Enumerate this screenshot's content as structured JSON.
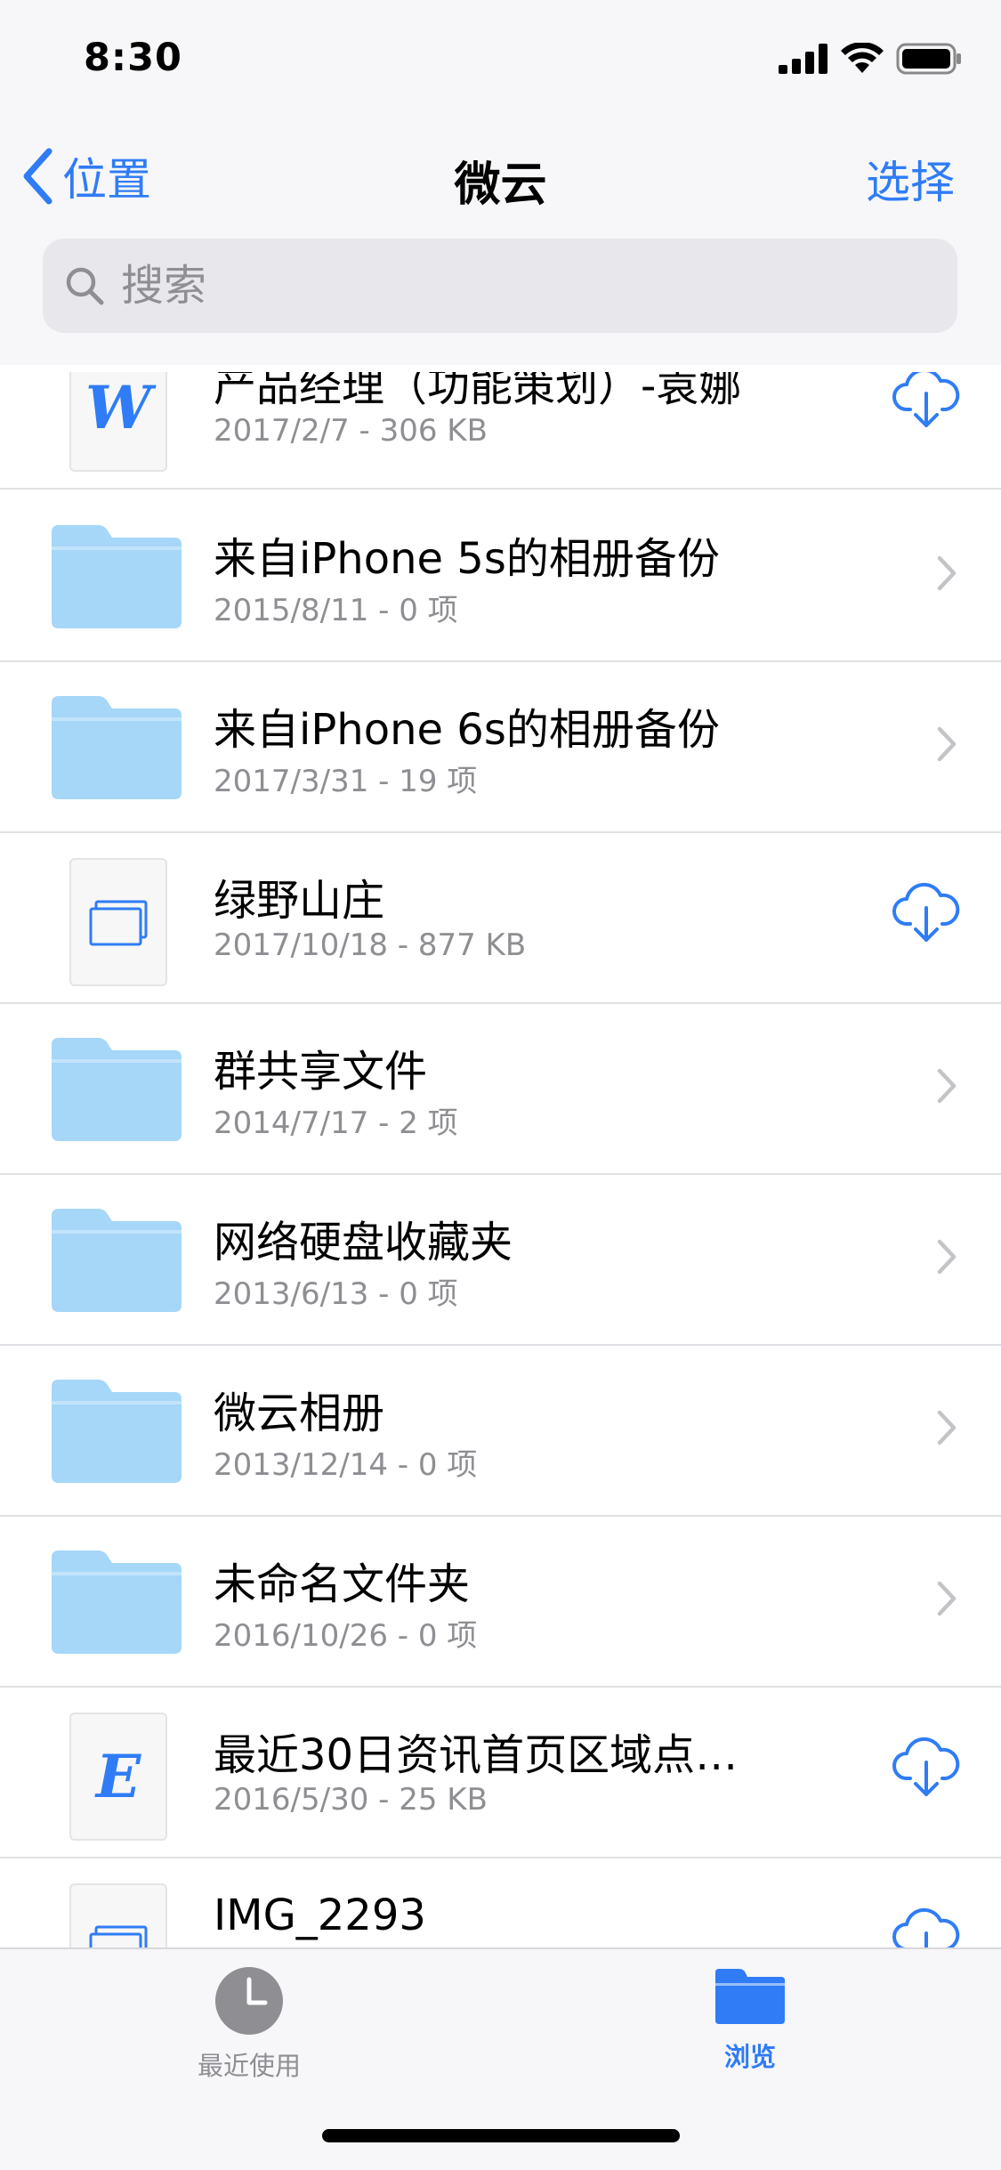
{
  "status_bar": {
    "time": "8:30"
  },
  "nav": {
    "back_label": "位置",
    "title": "微云",
    "select_label": "选择"
  },
  "search": {
    "placeholder": "搜索"
  },
  "items": [
    {
      "title": "产品经理（功能策划）-袁娜",
      "subtitle": "2017/2/7 - 306 KB",
      "kind": "doc",
      "letter": "W",
      "action": "download"
    },
    {
      "title": "来自iPhone 5s的相册备份",
      "subtitle": "2015/8/11 - 0 项",
      "kind": "folder",
      "action": "open"
    },
    {
      "title": "来自iPhone 6s的相册备份",
      "subtitle": "2017/3/31 - 19 项",
      "kind": "folder",
      "action": "open"
    },
    {
      "title": "绿野山庄",
      "subtitle": "2017/10/18 - 877 KB",
      "kind": "slides",
      "action": "download"
    },
    {
      "title": "群共享文件",
      "subtitle": "2014/7/17 - 2 项",
      "kind": "folder",
      "action": "open"
    },
    {
      "title": "网络硬盘收藏夹",
      "subtitle": "2013/6/13 - 0 项",
      "kind": "folder",
      "action": "open"
    },
    {
      "title": "微云相册",
      "subtitle": "2013/12/14 - 0 项",
      "kind": "folder",
      "action": "open"
    },
    {
      "title": "未命名文件夹",
      "subtitle": "2016/10/26 - 0 项",
      "kind": "folder",
      "action": "open"
    },
    {
      "title": "最近30日资讯首页区域点…",
      "subtitle": "2016/5/30 - 25 KB",
      "kind": "doc",
      "letter": "E",
      "action": "download"
    },
    {
      "title": "IMG_2293",
      "subtitle": "",
      "kind": "slides",
      "action": "download"
    }
  ],
  "tabs": {
    "recents_label": "最近使用",
    "browse_label": "浏览",
    "active": "browse",
    "active_color": "#2f7cf6",
    "inactive_color": "#8e8e93"
  },
  "colors": {
    "accent": "#2f7cf6",
    "folder": "#a6d6f8"
  }
}
